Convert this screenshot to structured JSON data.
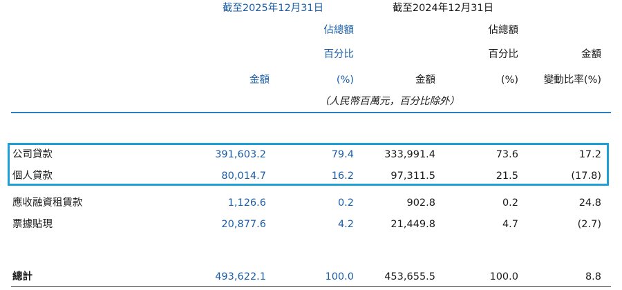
{
  "header": {
    "period_2025": "截至2025年12月31日",
    "period_2024": "截至2024年12月31日",
    "col_2025_amount": "金額",
    "col_2025_pct_line1": "佔總額",
    "col_2025_pct_line2": "百分比",
    "col_2025_pct_line3": "(%)",
    "col_2024_amount": "金額",
    "col_2024_pct_line1": "佔總額",
    "col_2024_pct_line2": "百分比",
    "col_2024_pct_line3": "(%)",
    "col_change_line1": "金額",
    "col_change_line2": "變動比率(%)",
    "unit_note": "（人民幣百萬元，百分比除外）"
  },
  "rows": [
    {
      "label": "公司貸款",
      "amt_2025": "391,603.2",
      "pct_2025": "79.4",
      "amt_2024": "333,991.4",
      "pct_2024": "73.6",
      "change": "17.2"
    },
    {
      "label": "個人貸款",
      "amt_2025": "80,014.7",
      "pct_2025": "16.2",
      "amt_2024": "97,311.5",
      "pct_2024": "21.5",
      "change": "(17.8)"
    },
    {
      "label": "應收融資租賃款",
      "amt_2025": "1,126.6",
      "pct_2025": "0.2",
      "amt_2024": "902.8",
      "pct_2024": "0.2",
      "change": "24.8"
    },
    {
      "label": "票據貼現",
      "amt_2025": "20,877.6",
      "pct_2025": "4.2",
      "amt_2024": "21,449.8",
      "pct_2024": "4.7",
      "change": "(2.7)"
    }
  ],
  "total": {
    "label": "總計",
    "amt_2025": "493,622.1",
    "pct_2025": "100.0",
    "amt_2024": "453,655.5",
    "pct_2024": "100.0",
    "change": "8.8"
  },
  "colors": {
    "accent_blue_text": "#1a5ea8",
    "header_rule": "#2a7fc2",
    "highlight_box": "#1d9fd8"
  }
}
